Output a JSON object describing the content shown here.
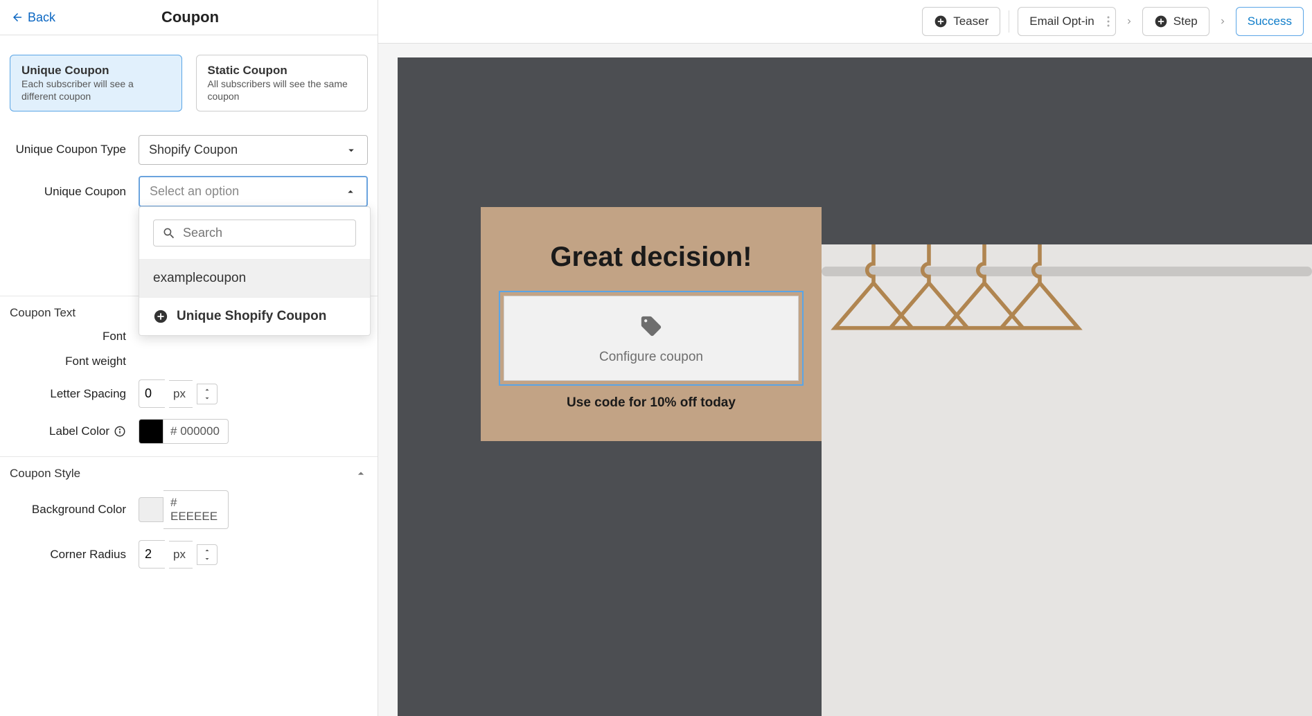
{
  "header": {
    "back": "Back",
    "title": "Coupon"
  },
  "coupon_types": {
    "unique": {
      "title": "Unique Coupon",
      "desc": "Each subscriber will see a different coupon"
    },
    "static": {
      "title": "Static Coupon",
      "desc": "All subscribers will see the same coupon"
    }
  },
  "form": {
    "type_label": "Unique Coupon Type",
    "type_value": "Shopify Coupon",
    "unique_label": "Unique Coupon",
    "unique_placeholder": "Select an option",
    "search_placeholder": "Search",
    "option_example": "examplecoupon",
    "option_add": "Unique Shopify Coupon"
  },
  "coupon_text": {
    "section": "Coupon Text",
    "font_label": "Font",
    "weight_label": "Font weight",
    "spacing_label": "Letter Spacing",
    "spacing_value": "0",
    "spacing_unit": "px",
    "color_label": "Label Color",
    "color_value": "000000",
    "color_swatch": "#000000"
  },
  "coupon_style": {
    "section": "Coupon Style",
    "bg_label": "Background Color",
    "bg_value": "EEEEEE",
    "bg_swatch": "#eeeeee",
    "radius_label": "Corner Radius",
    "radius_value": "2",
    "radius_unit": "px"
  },
  "steps": {
    "teaser": "Teaser",
    "email": "Email Opt-in",
    "step": "Step",
    "success": "Success"
  },
  "preview": {
    "headline": "Great decision!",
    "coupon_label": "Configure coupon",
    "sub": "Use code for 10% off today"
  }
}
